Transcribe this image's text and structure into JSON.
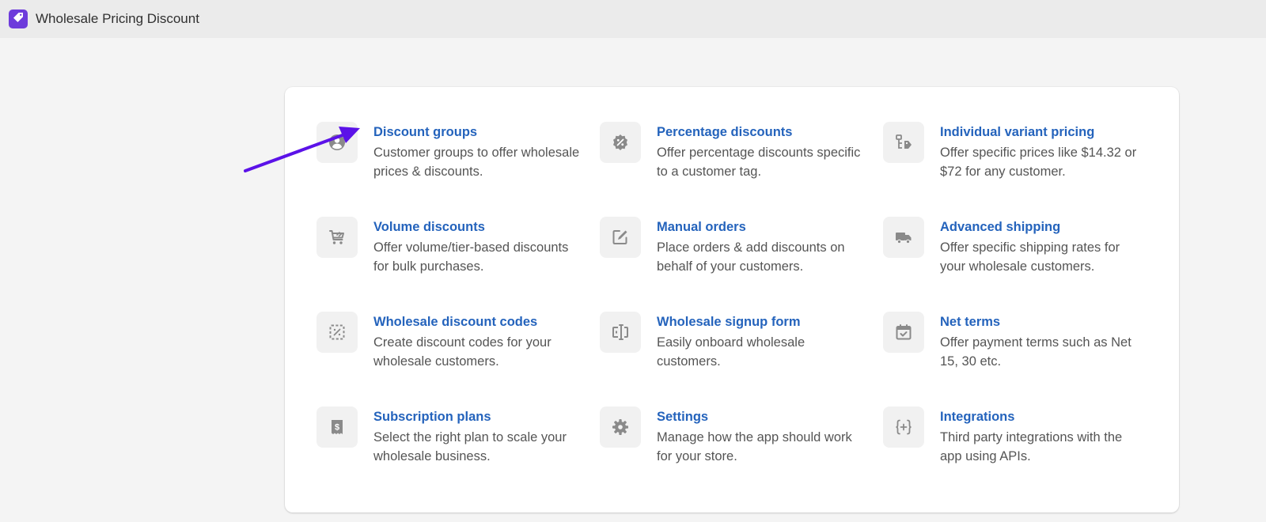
{
  "app": {
    "title": "Wholesale Pricing Discount",
    "brand_color": "#6d3bdb"
  },
  "colors": {
    "link": "#2463bc",
    "description": "#555555",
    "icon": "#8a8a8a",
    "annotation_arrow": "#5b12e8"
  },
  "features": [
    {
      "icon": "user-circle-icon",
      "title": "Discount groups",
      "description": "Customer groups to offer wholesale prices & discounts."
    },
    {
      "icon": "percent-badge-icon",
      "title": "Percentage discounts",
      "description": "Offer percentage discounts specific to a customer tag."
    },
    {
      "icon": "variant-tag-icon",
      "title": "Individual variant pricing",
      "description": "Offer specific prices like $14.32 or $72 for any customer."
    },
    {
      "icon": "cart-icon",
      "title": "Volume discounts",
      "description": "Offer volume/tier-based discounts for bulk purchases."
    },
    {
      "icon": "edit-icon",
      "title": "Manual orders",
      "description": "Place orders & add discounts on behalf of your customers."
    },
    {
      "icon": "truck-icon",
      "title": "Advanced shipping",
      "description": "Offer specific shipping rates for your wholesale customers."
    },
    {
      "icon": "discount-code-icon",
      "title": "Wholesale discount codes",
      "description": "Create discount codes for your wholesale customers."
    },
    {
      "icon": "form-icon",
      "title": "Wholesale signup form",
      "description": "Easily onboard wholesale customers."
    },
    {
      "icon": "calendar-check-icon",
      "title": "Net terms",
      "description": "Offer payment terms such as Net 15, 30 etc."
    },
    {
      "icon": "receipt-dollar-icon",
      "title": "Subscription plans",
      "description": "Select the right plan to scale your wholesale business."
    },
    {
      "icon": "gear-icon",
      "title": "Settings",
      "description": "Manage how the app should work for your store."
    },
    {
      "icon": "code-braces-icon",
      "title": "Integrations",
      "description": "Third party integrations with the app using APIs."
    }
  ]
}
